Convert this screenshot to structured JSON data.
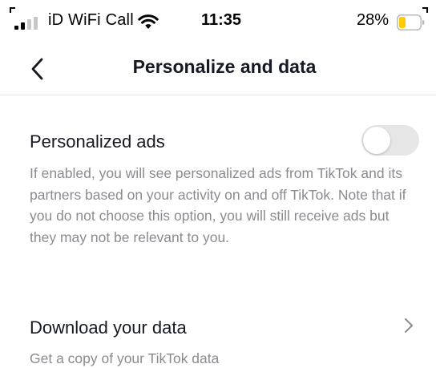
{
  "status_bar": {
    "carrier": "iD WiFi Call",
    "time": "11:35",
    "battery_percent": "28%",
    "battery_level": 0.28,
    "battery_color": "#FFCC00",
    "signal_bars_active": 2,
    "signal_icon": "cellular-signal-icon",
    "wifi_icon": "wifi-icon",
    "battery_icon": "battery-icon"
  },
  "nav": {
    "title": "Personalize and data",
    "back_icon": "chevron-left-icon"
  },
  "settings": {
    "personalized_ads": {
      "title": "Personalized ads",
      "description": "If enabled, you will see personalized ads from TikTok and its partners based on your activity on and off TikTok.  Note that if you do not choose this option, you will still receive ads but they may not be relevant to you.",
      "enabled": false
    },
    "download_data": {
      "title": "Download your data",
      "description": "Get a copy of your TikTok data",
      "icon": "chevron-right-icon"
    }
  },
  "colors": {
    "text_primary": "#161823",
    "text_secondary": "#8A8B91",
    "toggle_off": "#E6E6E7",
    "divider": "#E8E8E8"
  }
}
